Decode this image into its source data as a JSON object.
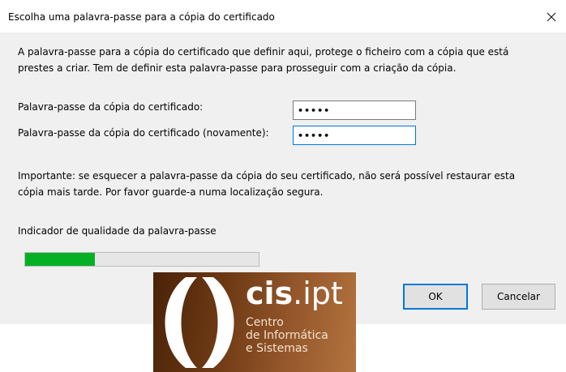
{
  "dialog": {
    "title": "Escolha uma palavra-passe para a cópia do certificado",
    "intro_line1": "A palavra-passe para a cópia do certificado que definir aqui, protege o ficheiro com a cópia que está",
    "intro_line2": "prestes a criar. Tem de definir esta palavra-passe para prosseguir com a criação da cópia.",
    "password_label": "Palavra-passe da cópia do certificado:",
    "password_value": "•••••",
    "confirm_label": "Palavra-passe da cópia do certificado (novamente):",
    "confirm_value": "•••••",
    "warning_line1": "Importante: se esquecer a palavra-passe da cópia do seu certificado, não será possível restaurar esta",
    "warning_line2": "cópia mais tarde. Por favor guarde-a numa localização segura.",
    "quality_label": "Indicador de qualidade da palavra-passe",
    "quality_level": 0.3,
    "quality_color": "#06b025",
    "ok_label": "OK",
    "cancel_label": "Cancelar",
    "close_icon": "close-icon"
  },
  "logo": {
    "brand_bold": "cis",
    "brand_rest": ".ipt",
    "line1": "Centro",
    "line2": "de Informática",
    "line3": "e Sistemas"
  }
}
